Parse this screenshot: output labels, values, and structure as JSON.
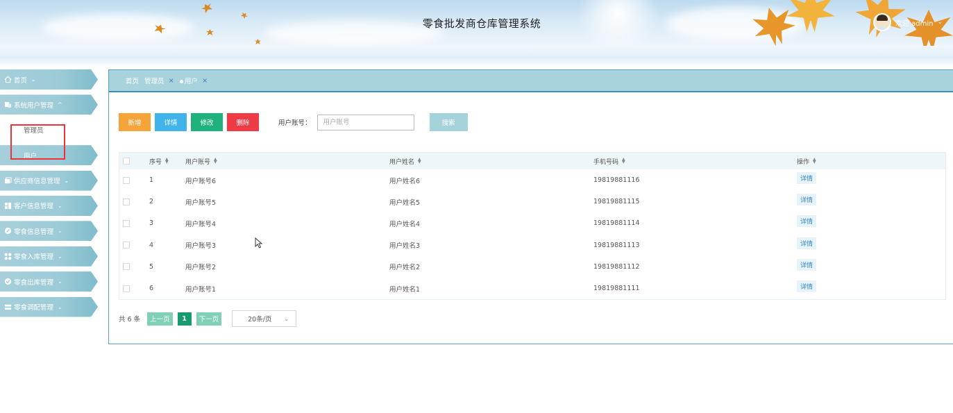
{
  "header": {
    "title": "零食批发商仓库管理系统",
    "user_label": "欢迎 admin",
    "caret": "⌄"
  },
  "sidebar": {
    "items": [
      {
        "label": "首页",
        "icon": "home-icon",
        "chevron": "⌄"
      },
      {
        "label": "系统用户管理",
        "icon": "users-icon",
        "chevron": "^"
      },
      {
        "label": "供应商信息管理",
        "icon": "supplier-icon",
        "chevron": "⌄"
      },
      {
        "label": "客户信息管理",
        "icon": "customer-icon",
        "chevron": "⌄"
      },
      {
        "label": "零食信息管理",
        "icon": "snack-icon",
        "chevron": "⌄"
      },
      {
        "label": "零食入库管理",
        "icon": "inbound-icon",
        "chevron": "⌄"
      },
      {
        "label": "零食出库管理",
        "icon": "outbound-icon",
        "chevron": "⌄"
      },
      {
        "label": "零食调配管理",
        "icon": "allocate-icon",
        "chevron": "⌄"
      }
    ],
    "sub_items": [
      {
        "label": "管理员",
        "active": false
      },
      {
        "label": "用户",
        "active": true
      }
    ]
  },
  "breadcrumb": {
    "home": "首页",
    "admin": "管理员",
    "current": "用户",
    "close": "×"
  },
  "toolbar": {
    "add": "新增",
    "detail": "详情",
    "edit": "修改",
    "delete": "删除",
    "search_label": "用户账号：",
    "search_placeholder": "用户账号",
    "search": "搜索"
  },
  "table": {
    "columns": [
      "序号",
      "用户账号",
      "用户姓名",
      "手机号码",
      "操作"
    ],
    "rows": [
      {
        "idx": "1",
        "account": "用户账号6",
        "name": "用户姓名6",
        "phone": "19819881116",
        "op": "详情"
      },
      {
        "idx": "2",
        "account": "用户账号5",
        "name": "用户姓名5",
        "phone": "19819881115",
        "op": "详情"
      },
      {
        "idx": "3",
        "account": "用户账号4",
        "name": "用户姓名4",
        "phone": "19819881114",
        "op": "详情"
      },
      {
        "idx": "4",
        "account": "用户账号3",
        "name": "用户姓名3",
        "phone": "19819881113",
        "op": "详情"
      },
      {
        "idx": "5",
        "account": "用户账号2",
        "name": "用户姓名2",
        "phone": "19819881112",
        "op": "详情"
      },
      {
        "idx": "6",
        "account": "用户账号1",
        "name": "用户姓名1",
        "phone": "19819881111",
        "op": "详情"
      }
    ]
  },
  "pager": {
    "total": "共 6 条",
    "prev": "上一页",
    "page": "1",
    "next": "下一页",
    "page_size": "20条/页"
  },
  "colors": {
    "sidebar": "#9ccbd7",
    "accent": "#3c8fc0",
    "add": "#f6a33a",
    "detail": "#3fb3ea",
    "edit": "#20b27c",
    "delete": "#ee3a44",
    "highlight_box": "#e8323c"
  }
}
